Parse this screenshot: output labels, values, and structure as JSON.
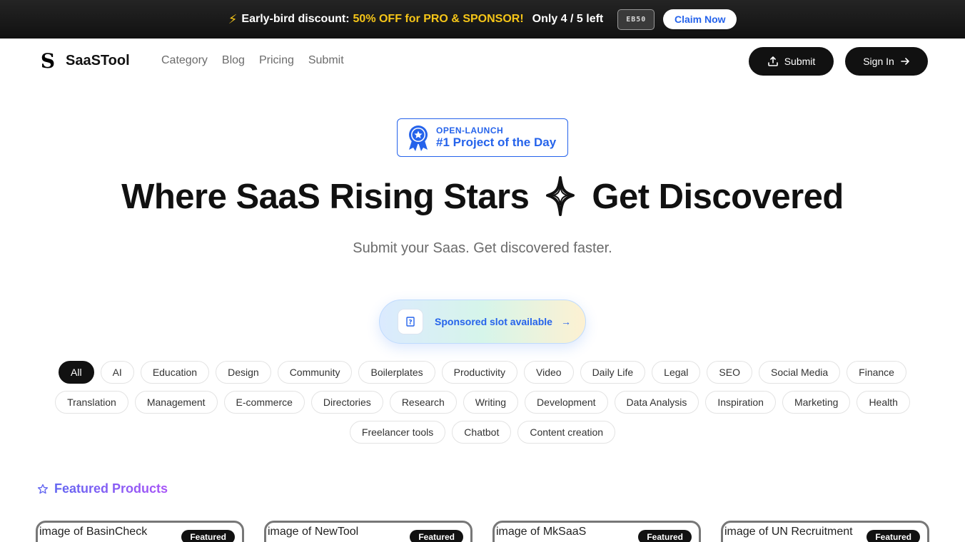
{
  "promo": {
    "lead": "Early-bird discount:",
    "deal": "50% OFF for PRO & SPONSOR!",
    "remaining": "Only 4 / 5 left",
    "code": "EB50",
    "cta": "Claim Now"
  },
  "nav": {
    "logo_letter": "S",
    "brand": "SaaSTool",
    "links": [
      "Category",
      "Blog",
      "Pricing",
      "Submit"
    ],
    "submit_label": "Submit",
    "signin_label": "Sign In"
  },
  "badge": {
    "small": "OPEN-LAUNCH",
    "big": "#1 Project of the Day"
  },
  "hero": {
    "title_before": "Where SaaS Rising Stars",
    "title_after": "Get Discovered",
    "subtitle": "Submit your Saas. Get discovered faster."
  },
  "sponsor": {
    "label": "Sponsored slot available",
    "arrow": "→",
    "icon_glyph": "?"
  },
  "categories": [
    "All",
    "AI",
    "Education",
    "Design",
    "Community",
    "Boilerplates",
    "Productivity",
    "Video",
    "Daily Life",
    "Legal",
    "SEO",
    "Social Media",
    "Finance",
    "Translation",
    "Management",
    "E-commerce",
    "Directories",
    "Research",
    "Writing",
    "Development",
    "Data Analysis",
    "Inspiration",
    "Marketing",
    "Health",
    "Freelancer tools",
    "Chatbot",
    "Content creation"
  ],
  "featured": {
    "title": "Featured Products",
    "cards": [
      {
        "alt": "image of BasinCheck",
        "badge": "Featured"
      },
      {
        "alt": "image of NewTool",
        "badge": "Featured"
      },
      {
        "alt": "image of MkSaaS",
        "badge": "Featured"
      },
      {
        "alt": "image of UN Recruitment",
        "badge": "Featured"
      }
    ]
  },
  "colors": {
    "accent": "#2563eb",
    "promo_highlight": "#f5c518",
    "dark_button": "#111111"
  }
}
